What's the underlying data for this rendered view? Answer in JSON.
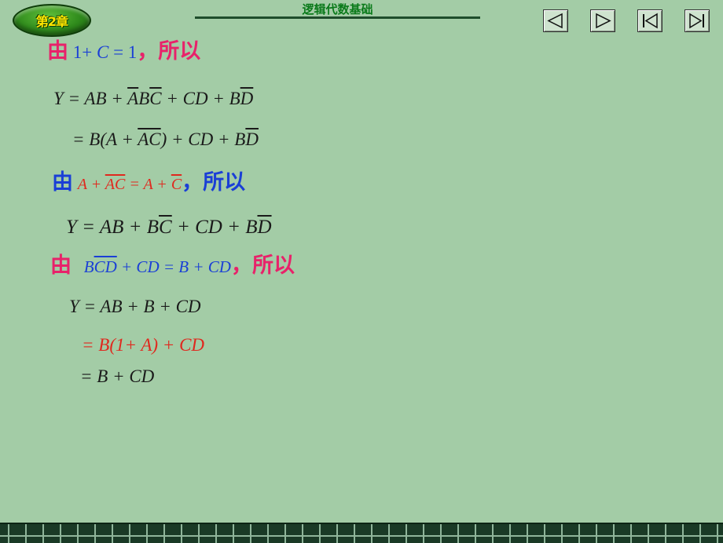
{
  "header": {
    "chapter_badge": "第2章",
    "title": "逻辑代数基础",
    "nav": [
      "prev-slide",
      "next-slide",
      "first-slide",
      "last-slide"
    ]
  },
  "content": {
    "by": "由",
    "so": "，所以",
    "cond1": {
      "a": "1+ ",
      "b": "C",
      "c": " = 1"
    },
    "eq1": {
      "y": "Y = ",
      "t1": "AB + ",
      "t2a": "A",
      "t2b": "B",
      "t2c": "C",
      "t3": " + CD + ",
      "t4a": "B",
      "t4b": "D"
    },
    "eq2": {
      "a": "= ",
      "b": "B(A + ",
      "c": "AC",
      "d": ") + CD + ",
      "e": "B",
      "f": "D"
    },
    "cond2": {
      "a": "A + ",
      "b": "AC",
      "c": " = ",
      "d": "A + ",
      "e": "C"
    },
    "eq3": {
      "y": "Y = ",
      "a": "AB + ",
      "b": "B",
      "c": "C",
      "d": " + CD + ",
      "e": "B",
      "f": "D"
    },
    "cond3": {
      "a": "B",
      "b": "CD",
      "c": " + CD = ",
      "d": "B + CD"
    },
    "eq4": "Y =  AB + B + CD",
    "eq5": "= B(1+ A) + CD",
    "eq6": "= B + CD"
  },
  "colors": {
    "background": "#a3cca6",
    "accent_pink": "#e8226a",
    "accent_blue": "#1a3fd6",
    "accent_red": "#e0281e"
  }
}
